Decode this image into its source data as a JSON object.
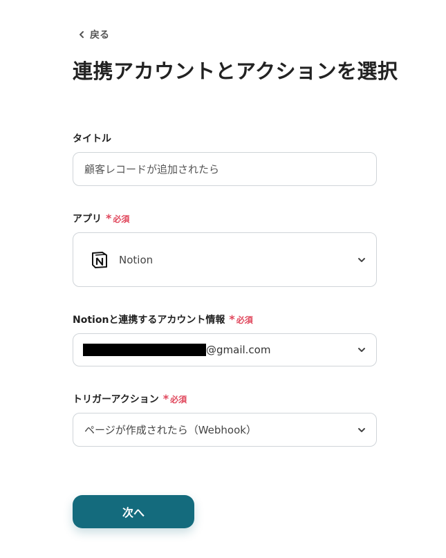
{
  "nav": {
    "back_label": "戻る"
  },
  "page": {
    "title": "連携アカウントとアクションを選択"
  },
  "fields": {
    "title": {
      "label": "タイトル",
      "value": "顧客レコードが追加されたら"
    },
    "app": {
      "label": "アプリ",
      "required_label": "必須",
      "value": "Notion",
      "icon": "notion-logo-icon"
    },
    "account": {
      "label": "Notionと連携するアカウント情報",
      "required_label": "必須",
      "value_suffix": "@gmail.com"
    },
    "trigger": {
      "label": "トリガーアクション",
      "required_label": "必須",
      "value": "ページが作成されたら（Webhook）"
    }
  },
  "actions": {
    "next_label": "次へ"
  },
  "colors": {
    "accent": "#146b7d",
    "required": "#e0475c",
    "border": "#cfd4d8"
  }
}
